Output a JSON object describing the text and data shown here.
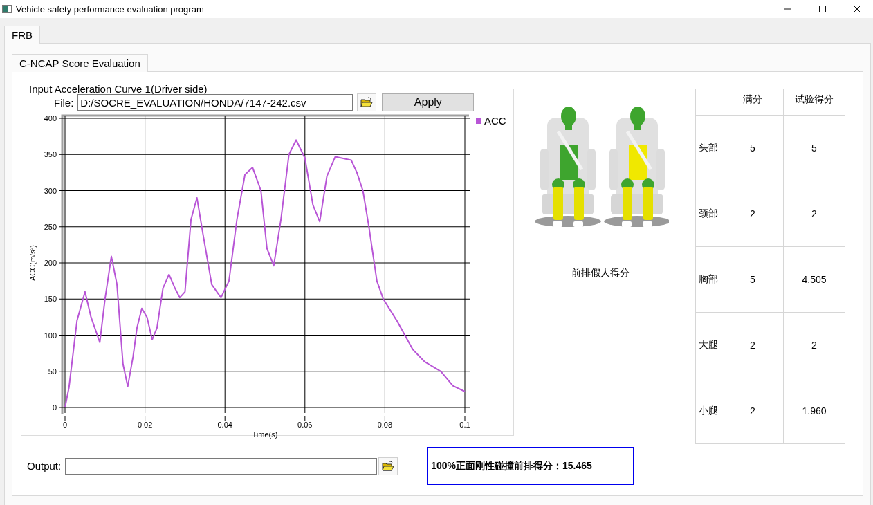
{
  "window": {
    "title": "Vehicle safety performance evaluation program"
  },
  "outer_tabs": [
    {
      "label": "FRB",
      "selected": true
    }
  ],
  "inner_tabs": [
    {
      "label": "C-NCAP Score Evaluation",
      "selected": true
    }
  ],
  "curve_group": {
    "title": "Input Acceleration Curve 1(Driver side)",
    "file_label": "File:",
    "file_value": "D:/SOCRE_EVALUATION/HONDA/7147-242.csv",
    "apply_button": "Apply",
    "chart_data": {
      "type": "line",
      "grid": true,
      "xlabel": "Time(s)",
      "ylabel": "ACC(m/s²)",
      "xlim": [
        0,
        0.1
      ],
      "ylim": [
        0,
        400
      ],
      "xticks": [
        0,
        0.02,
        0.04,
        0.06,
        0.08,
        0.1
      ],
      "yticks": [
        0,
        50,
        100,
        150,
        200,
        250,
        300,
        350,
        400
      ],
      "x": [
        0,
        0.001,
        0.003,
        0.005,
        0.0065,
        0.0087,
        0.01,
        0.0116,
        0.013,
        0.0145,
        0.0157,
        0.017,
        0.018,
        0.0192,
        0.0205,
        0.0218,
        0.023,
        0.0245,
        0.026,
        0.0275,
        0.0287,
        0.03,
        0.0315,
        0.033,
        0.0345,
        0.0367,
        0.039,
        0.041,
        0.043,
        0.045,
        0.0469,
        0.049,
        0.0505,
        0.0522,
        0.054,
        0.056,
        0.0578,
        0.06,
        0.062,
        0.0637,
        0.0655,
        0.0676,
        0.0716,
        0.073,
        0.0745,
        0.076,
        0.078,
        0.0796,
        0.083,
        0.087,
        0.09,
        0.094,
        0.097,
        0.1
      ],
      "series": [
        {
          "name": "ACC",
          "color": "#b855d6",
          "values": [
            0,
            28,
            120,
            160,
            125,
            90,
            150,
            209,
            170,
            60,
            29,
            70,
            110,
            137,
            125,
            94,
            110,
            165,
            184,
            165,
            152,
            160,
            260,
            290,
            240,
            170,
            152,
            175,
            260,
            322,
            332,
            300,
            220,
            196,
            260,
            350,
            370,
            345,
            280,
            257,
            320,
            347,
            342,
            325,
            300,
            250,
            175,
            150,
            120,
            80,
            63,
            50,
            30,
            22
          ]
        }
      ]
    }
  },
  "dummy_caption": "前排假人得分",
  "score_table": {
    "columns": [
      "满分",
      "试验得分"
    ],
    "rows": [
      {
        "part": "头部",
        "full": "5",
        "score": "5"
      },
      {
        "part": "颈部",
        "full": "2",
        "score": "2"
      },
      {
        "part": "胸部",
        "full": "5",
        "score": "4.505"
      },
      {
        "part": "大腿",
        "full": "2",
        "score": "2"
      },
      {
        "part": "小腿",
        "full": "2",
        "score": "1.960"
      }
    ]
  },
  "output": {
    "label": "Output:"
  },
  "result": "100%正面刚性碰撞前排得分：15.465"
}
